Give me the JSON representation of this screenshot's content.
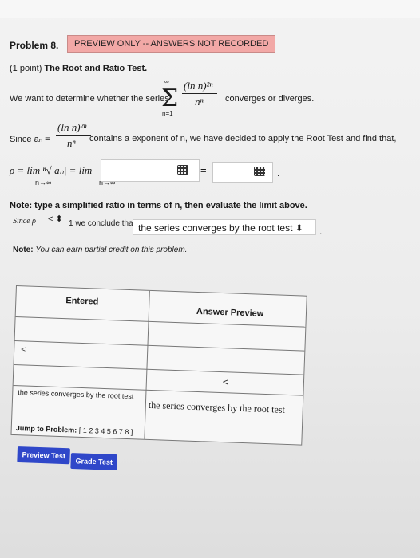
{
  "problem": {
    "title": "Problem 8.",
    "badge": "PREVIEW ONLY -- ANSWERS NOT RECORDED",
    "points": "(1 point)",
    "heading": "The Root and Ratio Test."
  },
  "statement": {
    "intro": "We want to determine whether the series",
    "sigma_top": "∞",
    "sigma_bottom": "n=1",
    "numerator": "(ln n)²ⁿ",
    "denominator": "nⁿ",
    "tail": "converges or diverges."
  },
  "since_line": {
    "lead": "Since aₙ =",
    "numerator": "(ln n)²ⁿ",
    "denominator": "nⁿ",
    "tail": "contains a exponent of n, we have decided to apply the Root Test and find that,"
  },
  "rho_line": {
    "text": "ρ = lim ⁿ√|aₙ| = lim",
    "sub1": "n→∞",
    "sub2": "n→∞",
    "equals": "=",
    "period": ".",
    "answer1": "",
    "answer2": ""
  },
  "note1": "Note: type a simplified ratio in terms of n, then evaluate the limit above.",
  "conclusion": {
    "since_rho": "Since ρ",
    "comparison": "<",
    "mid": "1 we conclude that",
    "result": "the series converges by the root test ⬍",
    "period": "."
  },
  "note2": {
    "label": "Note:",
    "text": "You can earn partial credit on this problem."
  },
  "results_table": {
    "headers": [
      "Entered",
      "Answer Preview"
    ],
    "row1_entered": "<",
    "row1_preview": "<",
    "row2_entered": "the series converges by the root test",
    "row2_preview": "the series converges by the root test"
  },
  "jump": {
    "label": "Jump to Problem:",
    "open": "[",
    "pages": "1 2 3 4 5 6 7 8",
    "close": "]"
  },
  "buttons": {
    "preview": "Preview Test",
    "grade": "Grade Test"
  }
}
